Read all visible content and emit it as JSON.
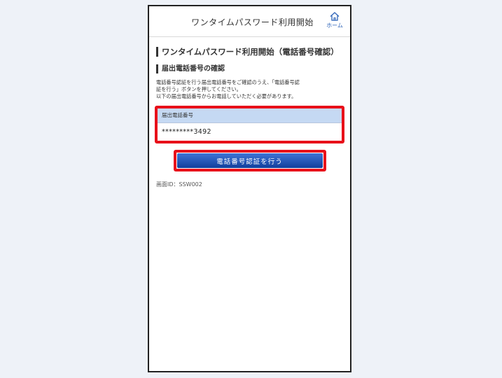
{
  "header": {
    "title": "ワンタイムパスワード利用開始",
    "home_label": "ホーム"
  },
  "main": {
    "heading": "ワンタイムパスワード利用開始（電話番号確認）",
    "subheading": "届出電話番号の確認",
    "description_lines": [
      "電話番号認証を行う届出電話番号をご確認のうえ、「電話番号認",
      "証を行う」ボタンを押してください。",
      "以下の届出電話番号からお電話していただく必要があります。"
    ],
    "phone_box": {
      "label": "届出電話番号",
      "value": "*********3492"
    },
    "verify_button_label": "電話番号認証を行う",
    "screen_id": "画面ID：SSW002"
  },
  "colors": {
    "highlight": "#e8101a",
    "button": "#1f4fb0",
    "table_head": "#c5d9f3",
    "link": "#2d63b8"
  },
  "icons": {
    "home": "home-icon"
  }
}
